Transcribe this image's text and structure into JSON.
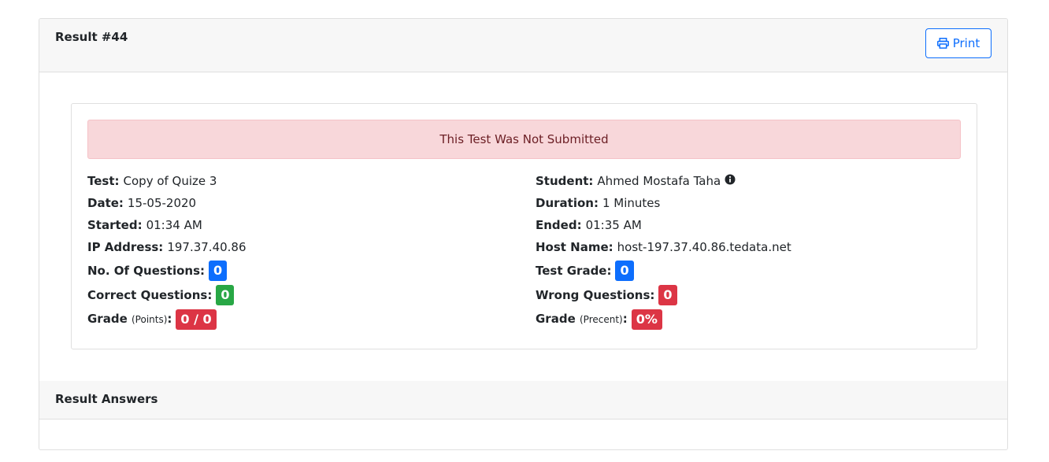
{
  "header": {
    "title": "Result #44",
    "print_label": "Print"
  },
  "alert": {
    "message": "This Test Was Not Submitted"
  },
  "details": {
    "test_label": "Test:",
    "test_value": "Copy of Quize 3",
    "date_label": "Date:",
    "date_value": "15-05-2020",
    "started_label": "Started:",
    "started_value": "01:34 AM",
    "ip_label": "IP Address:",
    "ip_value": "197.37.40.86",
    "questions_label": "No. Of Questions:",
    "questions_value": "0",
    "correct_label": "Correct Questions:",
    "correct_value": "0",
    "grade_points_label": "Grade",
    "grade_points_sub": "(Points)",
    "grade_points_value": "0 / 0",
    "student_label": "Student:",
    "student_value": "Ahmed Mostafa Taha",
    "duration_label": "Duration:",
    "duration_value": "1 Minutes",
    "ended_label": "Ended:",
    "ended_value": "01:35 AM",
    "host_label": "Host Name:",
    "host_value": "host-197.37.40.86.tedata.net",
    "test_grade_label": "Test Grade:",
    "test_grade_value": "0",
    "wrong_label": "Wrong Questions:",
    "wrong_value": "0",
    "grade_percent_label": "Grade",
    "grade_percent_sub": "(Precent)",
    "grade_percent_value": "0%"
  },
  "answers": {
    "title": "Result Answers"
  },
  "colors": {
    "primary": "#0d6efd",
    "success": "#28a745",
    "danger": "#dc3545",
    "alert_bg": "#f8d7da"
  },
  "icons": {
    "print": "printer-icon",
    "info": "info-circle-icon"
  }
}
